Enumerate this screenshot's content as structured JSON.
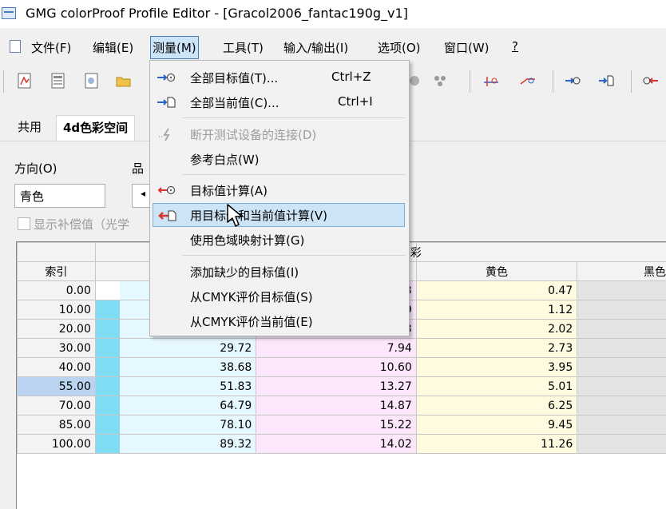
{
  "window": {
    "title": "GMG colorProof Profile Editor - [Gracol2006_fantac190g_v1]"
  },
  "menubar": [
    "文件(F)",
    "编辑(E)",
    "测量(M)",
    "工具(T)",
    "输入/输出(I)",
    "选项(O)",
    "窗口(W)",
    "?"
  ],
  "tabs": [
    "共用",
    "4d色彩空间"
  ],
  "form": {
    "direction_label": "方向(O)",
    "quality_label": "品",
    "direction_value": "青色",
    "show_comp_label": "显示补偿值（光学"
  },
  "grid": {
    "group_header": "色彩",
    "col_index": "索引",
    "col_yellow": "黄色",
    "col_black": "黑色",
    "rows": [
      {
        "idx": "0.00",
        "cyan": "",
        "mag": "3",
        "yel": "0.47"
      },
      {
        "idx": "10.00",
        "cyan": "",
        "mag": "9",
        "yel": "1.12"
      },
      {
        "idx": "20.00",
        "cyan": "",
        "mag": "3",
        "yel": "2.02"
      },
      {
        "idx": "30.00",
        "cyan": "29.72",
        "mag": "7.94",
        "yel": "2.73"
      },
      {
        "idx": "40.00",
        "cyan": "38.68",
        "mag": "10.60",
        "yel": "3.95"
      },
      {
        "idx": "55.00",
        "cyan": "51.83",
        "mag": "13.27",
        "yel": "5.01"
      },
      {
        "idx": "70.00",
        "cyan": "64.79",
        "mag": "14.87",
        "yel": "6.25"
      },
      {
        "idx": "85.00",
        "cyan": "78.10",
        "mag": "15.22",
        "yel": "9.45"
      },
      {
        "idx": "100.00",
        "cyan": "89.32",
        "mag": "14.02",
        "yel": "11.26"
      }
    ]
  },
  "menu": {
    "items": [
      {
        "label": "全部目标值(T)...",
        "shortcut": "Ctrl+Z"
      },
      {
        "label": "全部当前值(C)...",
        "shortcut": "Ctrl+I"
      },
      {
        "label": "断开测试设备的连接(D)",
        "shortcut": ""
      },
      {
        "label": "参考白点(W)",
        "shortcut": ""
      },
      {
        "label": "目标值计算(A)",
        "shortcut": ""
      },
      {
        "label": "用目标值和当前值计算(V)",
        "shortcut": ""
      },
      {
        "label": "使用色域映射计算(G)",
        "shortcut": ""
      },
      {
        "label": "添加缺少的目标值(I)",
        "shortcut": ""
      },
      {
        "label": "从CMYK评价目标值(S)",
        "shortcut": ""
      },
      {
        "label": "从CMYK评价当前值(E)",
        "shortcut": ""
      }
    ]
  },
  "colors": {
    "highlight": "#cde4f7",
    "accent": "#2b62c8",
    "red_icon": "#d9342b"
  }
}
